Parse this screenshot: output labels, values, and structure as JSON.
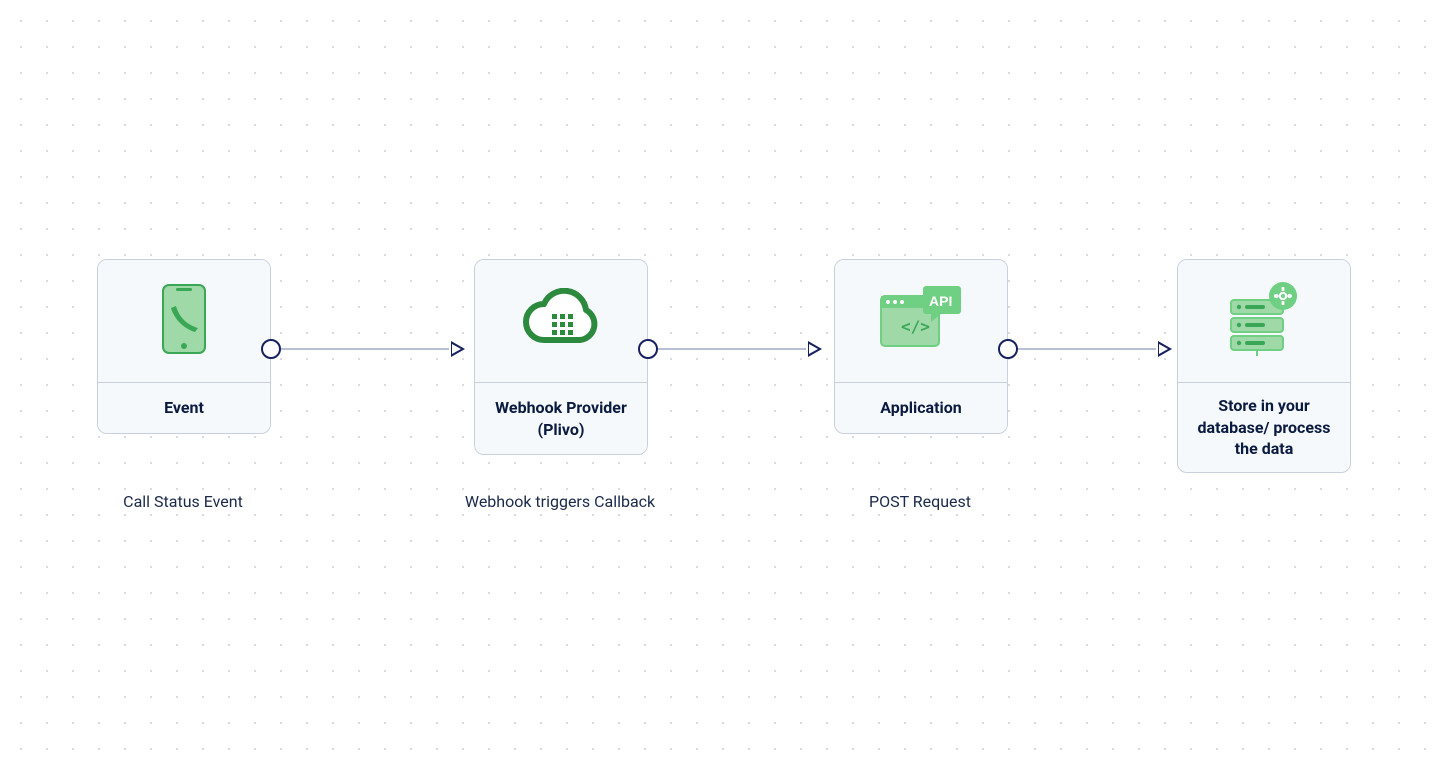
{
  "nodes": [
    {
      "label": "Event",
      "caption": "Call Status Event"
    },
    {
      "label": "Webhook Provider (Plivo)",
      "caption": "Webhook triggers Callback"
    },
    {
      "label": "Application",
      "caption": "POST Request"
    },
    {
      "label": "Store in your database/ process the data",
      "caption": ""
    }
  ],
  "colors": {
    "iconPrimary": "#3aa757",
    "iconLight": "#9fd9a7",
    "iconStroke": "#2b8a3e",
    "nodeBorder": "#c9d0db",
    "connector": "#17205f"
  }
}
